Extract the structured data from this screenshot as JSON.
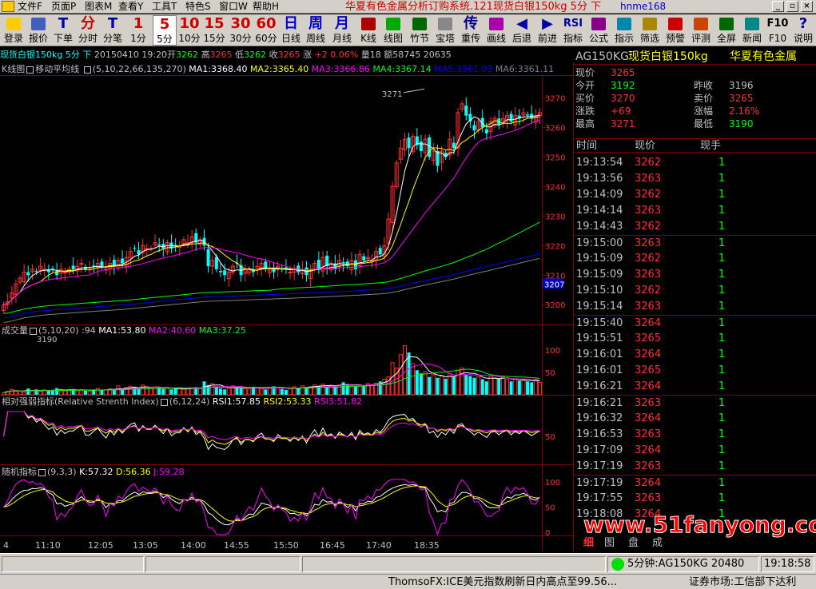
{
  "menu": {
    "items": [
      "文件F",
      "页面P",
      "图表M",
      "查看Y",
      "工具T",
      "特色S",
      "窗口W",
      "帮助H"
    ]
  },
  "app_title": "华夏有色金属分析订购系统.121现货白银150kg 5分 下",
  "user": "hnme168",
  "toolbar": {
    "buttons": [
      {
        "glyph": "",
        "label": "登录"
      },
      {
        "glyph": "",
        "label": "报价"
      },
      {
        "glyph": "T",
        "label": "下单"
      },
      {
        "glyph": "分",
        "label": "分时"
      },
      {
        "glyph": "T",
        "label": "分笔"
      },
      {
        "glyph": "1",
        "label": "1分"
      },
      {
        "glyph": "5",
        "label": "5分"
      },
      {
        "glyph": "10",
        "label": "10分"
      },
      {
        "glyph": "15",
        "label": "15分"
      },
      {
        "glyph": "30",
        "label": "30分"
      },
      {
        "glyph": "60",
        "label": "60分"
      },
      {
        "glyph": "日",
        "label": "日线"
      },
      {
        "glyph": "周",
        "label": "周线"
      },
      {
        "glyph": "月",
        "label": "月线"
      },
      {
        "glyph": "",
        "label": "K线"
      },
      {
        "glyph": "",
        "label": "线图"
      },
      {
        "glyph": "",
        "label": "竹节"
      },
      {
        "glyph": "",
        "label": "宝塔"
      },
      {
        "glyph": "传",
        "label": "重传"
      },
      {
        "glyph": "",
        "label": "画线"
      },
      {
        "glyph": "◀",
        "label": "后退"
      },
      {
        "glyph": "▶",
        "label": "前进"
      },
      {
        "glyph": "RSI",
        "label": "指标"
      },
      {
        "glyph": "",
        "label": "公式"
      },
      {
        "glyph": "",
        "label": "指示"
      },
      {
        "glyph": "",
        "label": "筛选"
      },
      {
        "glyph": "",
        "label": "预警"
      },
      {
        "glyph": "",
        "label": "评测"
      },
      {
        "glyph": "",
        "label": "全屏"
      },
      {
        "glyph": "",
        "label": "新闻"
      },
      {
        "glyph": "F10",
        "label": "F10"
      },
      {
        "glyph": "?",
        "label": "说明"
      }
    ]
  },
  "quote_line": {
    "name": "现货白银150kg",
    "period": "5分",
    "dir": "下",
    "date": "20150410",
    "time": "19:20",
    "open_label": "开",
    "open": "3262",
    "high_label": "高",
    "high": "3265",
    "low_label": "低",
    "low": "3262",
    "close_label": "收",
    "close": "3265",
    "chg_label": "涨",
    "chg": "+2",
    "chg_pct": "0.06%",
    "vol_label": "量",
    "vol": "18",
    "amt_label": "额",
    "amt": "58745",
    "oi": "20635"
  },
  "ma_legend": {
    "prefix": "K线图",
    "name": "移动平均线",
    "params": "(5,10,22,66,135,270)",
    "items": [
      {
        "label": "MA1:3368.40",
        "color": "#ffffff"
      },
      {
        "label": "MA2:3365.40",
        "color": "#ffff00"
      },
      {
        "label": "MA3:3366.86",
        "color": "#ff00ff"
      },
      {
        "label": "MA4:3367.14",
        "color": "#00ff00"
      },
      {
        "label": "MA5:3361.03",
        "color": "#0000ff"
      },
      {
        "label": "MA6:3361.11",
        "color": "#808080"
      }
    ]
  },
  "vol_legend": {
    "name": "成交量",
    "params": "(5,10,20)",
    "value": ":94",
    "items": [
      {
        "label": "MA1:53.80",
        "color": "#ffffff"
      },
      {
        "label": "MA2:40.60",
        "color": "#ff00ff"
      },
      {
        "label": "MA3:37.25",
        "color": "#00ff00"
      }
    ]
  },
  "rsi_legend": {
    "name": "相对强弱指标(Relative Strenth Index)",
    "params": "(6,12,24)",
    "items": [
      {
        "label": "RSI1:57.85",
        "color": "#ffffff"
      },
      {
        "label": "RSI2:53.33",
        "color": "#ffff00"
      },
      {
        "label": "RSI3:51.82",
        "color": "#ff00ff"
      }
    ]
  },
  "kdj_legend": {
    "name": "随机指标",
    "params": "(9,3,3)",
    "items": [
      {
        "label": "K:57.32",
        "color": "#ffffff"
      },
      {
        "label": "D:56.36",
        "color": "#ffff00"
      },
      {
        "label": "J:59.28",
        "color": "#ff00ff"
      }
    ]
  },
  "chart_data": {
    "type": "candlestick",
    "title": "现货白银150kg 5分",
    "price_axis": [
      3270,
      3260,
      3250,
      3240,
      3230,
      3220,
      3210,
      3200
    ],
    "price_range": [
      3196,
      3275
    ],
    "current_price_tag": "3207",
    "annotations": [
      {
        "text": "3271",
        "value": 3271
      },
      {
        "text": "3190",
        "value": 3190
      }
    ],
    "volume_axis": [
      100,
      50
    ],
    "rsi_axis": [
      50
    ],
    "kdj_axis": [
      100,
      50,
      0
    ],
    "x_ticks": [
      "4",
      "11:10",
      "12:05",
      "13:05",
      "14:00",
      "14:55",
      "15:50",
      "16:45",
      "17:40",
      "18:35"
    ],
    "closes": [
      3200,
      3201,
      3204,
      3207,
      3209,
      3211,
      3210,
      3212,
      3211,
      3213,
      3212,
      3211,
      3212,
      3210,
      3212,
      3211,
      3212,
      3212,
      3213,
      3214,
      3212,
      3212,
      3213,
      3214,
      3213,
      3212,
      3214,
      3213,
      3215,
      3214,
      3216,
      3218,
      3219,
      3217,
      3220,
      3219,
      3219,
      3221,
      3220,
      3219,
      3221,
      3219,
      3220,
      3220,
      3222,
      3221,
      3223,
      3221,
      3222,
      3220,
      3213,
      3215,
      3212,
      3211,
      3210,
      3211,
      3213,
      3214,
      3210,
      3212,
      3212,
      3211,
      3213,
      3214,
      3212,
      3212,
      3211,
      3213,
      3212,
      3212,
      3211,
      3212,
      3211,
      3212,
      3210,
      3212,
      3214,
      3212,
      3216,
      3213,
      3214,
      3212,
      3215,
      3214,
      3213,
      3215,
      3212,
      3217,
      3215,
      3216,
      3215,
      3218,
      3217,
      3220,
      3229,
      3240,
      3248,
      3253,
      3256,
      3253,
      3257,
      3254,
      3252,
      3256,
      3250,
      3252,
      3247,
      3252,
      3250,
      3256,
      3253,
      3265,
      3268,
      3264,
      3262,
      3259,
      3262,
      3260,
      3258,
      3262,
      3263,
      3261,
      3263,
      3264,
      3262,
      3264,
      3263,
      3265,
      3264,
      3263,
      3264,
      3265
    ],
    "volumes": [
      5,
      8,
      12,
      10,
      9,
      6,
      14,
      9,
      12,
      8,
      10,
      9,
      11,
      15,
      12,
      9,
      10,
      13,
      11,
      12,
      9,
      8,
      12,
      14,
      10,
      11,
      13,
      12,
      20,
      12,
      16,
      19,
      18,
      14,
      22,
      16,
      15,
      18,
      17,
      13,
      15,
      12,
      14,
      16,
      12,
      13,
      15,
      17,
      14,
      30,
      22,
      25,
      18,
      14,
      12,
      15,
      20,
      17,
      15,
      14,
      13,
      18,
      16,
      14,
      12,
      15,
      19,
      17,
      13,
      11,
      14,
      18,
      15,
      20,
      16,
      18,
      22,
      20,
      24,
      18,
      21,
      19,
      22,
      28,
      24,
      20,
      18,
      22,
      20,
      25,
      23,
      26,
      30,
      35,
      40,
      72,
      60,
      90,
      110,
      95,
      70,
      55,
      48,
      52,
      40,
      45,
      38,
      42,
      36,
      48,
      40,
      55,
      60,
      45,
      42,
      38,
      40,
      35,
      30,
      42,
      38,
      36,
      40,
      34,
      30,
      36,
      32,
      34,
      30,
      28,
      35,
      28
    ],
    "ma_series": [
      "MA1",
      "MA2",
      "MA3",
      "MA4",
      "MA5",
      "MA6"
    ]
  },
  "right": {
    "title_code": "AG150KG",
    "title_name": "现货白银150kg",
    "title_company": "华夏有色金属",
    "quotes": [
      {
        "label": "现价",
        "value": "3265",
        "color": "#ff3030"
      },
      {
        "label": "今开",
        "value": "3192",
        "color": "#00ff00"
      },
      {
        "label": "昨收",
        "value": "3196",
        "color": "#c0c0c0"
      },
      {
        "label": "买价",
        "value": "3270",
        "color": "#ff3030"
      },
      {
        "label": "卖价",
        "value": "3265",
        "color": "#ff3030"
      },
      {
        "label": "涨跌",
        "value": "+69",
        "color": "#ff3030"
      },
      {
        "label": "涨幅",
        "value": "2.16%",
        "color": "#ff3030"
      },
      {
        "label": "最高",
        "value": "3271",
        "color": "#ff3030"
      },
      {
        "label": "最低",
        "value": "3190",
        "color": "#00ff00"
      }
    ],
    "tick_header": [
      "时间",
      "现价",
      "现手"
    ],
    "ticks": [
      {
        "t": "19:13:54",
        "p": "3262",
        "v": "1"
      },
      {
        "t": "19:13:56",
        "p": "3263",
        "v": "1"
      },
      {
        "t": "19:14:09",
        "p": "3262",
        "v": "1"
      },
      {
        "t": "19:14:14",
        "p": "3263",
        "v": "1"
      },
      {
        "t": "19:14:43",
        "p": "3262",
        "v": "1"
      },
      {
        "t": "19:15:00",
        "p": "3263",
        "v": "1"
      },
      {
        "t": "19:15:09",
        "p": "3262",
        "v": "1"
      },
      {
        "t": "19:15:09",
        "p": "3263",
        "v": "1"
      },
      {
        "t": "19:15:10",
        "p": "3262",
        "v": "1"
      },
      {
        "t": "19:15:14",
        "p": "3263",
        "v": "1"
      },
      {
        "t": "19:15:40",
        "p": "3264",
        "v": "1"
      },
      {
        "t": "19:15:51",
        "p": "3265",
        "v": "1"
      },
      {
        "t": "19:16:01",
        "p": "3264",
        "v": "1"
      },
      {
        "t": "19:16:01",
        "p": "3265",
        "v": "1"
      },
      {
        "t": "19:16:21",
        "p": "3264",
        "v": "1"
      },
      {
        "t": "19:16:21",
        "p": "3263",
        "v": "1"
      },
      {
        "t": "19:16:32",
        "p": "3264",
        "v": "1"
      },
      {
        "t": "19:16:53",
        "p": "3263",
        "v": "1"
      },
      {
        "t": "19:17:09",
        "p": "3264",
        "v": "1"
      },
      {
        "t": "19:17:19",
        "p": "3263",
        "v": "1"
      },
      {
        "t": "19:17:19",
        "p": "3264",
        "v": "1"
      },
      {
        "t": "19:17:55",
        "p": "3263",
        "v": "1"
      },
      {
        "t": "19:18:08",
        "p": "3264",
        "v": "1"
      }
    ],
    "tabs": [
      "细",
      "图",
      "盘",
      "成"
    ]
  },
  "watermark": "www.51fanyong.com",
  "status": {
    "indicator_text": "5分钟:AG150KG 20480",
    "clock": "19:18:58",
    "ticker": "ThomsoFX:ICE美元指数刷新日内高点至99.56...",
    "market": "证券市场:工信部下达利"
  }
}
